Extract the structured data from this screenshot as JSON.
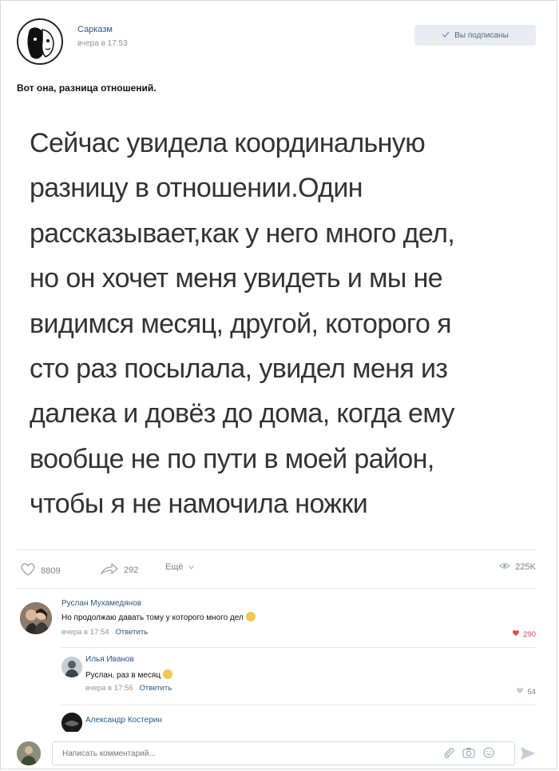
{
  "post": {
    "group_name": "Сарказм",
    "time": "вчера в 17:53",
    "subscribe_label": "Вы подписаны",
    "caption": "Вот она, разница отношений.",
    "body_lines": [
      "Сейчас увидела координальную",
      "разницу в отношении.Один",
      "рассказывает,как у него много дел,",
      "но он хочет меня увидеть и мы не",
      "видимся месяц, другой, которого я",
      "сто раз посылала, увидел меня из",
      "далека и довёз до дома, когда ему",
      "вообще не по пути в моей район,",
      "чтобы я не намочила ножки"
    ]
  },
  "actions": {
    "likes": "8809",
    "shares": "292",
    "more": "Ещё",
    "views": "225K"
  },
  "comments": [
    {
      "author": "Руслан Мухамедянов",
      "text": "Но продолжаю давать тому у которого много дел",
      "time": "вчера в 17:54",
      "reply": "Ответить",
      "likes": "290",
      "liked": true,
      "emoji": "laugh-cry-emoji"
    },
    {
      "author": "Илья Иванов",
      "text": "Руслан, раз в месяц",
      "time": "вчера в 17:56",
      "reply": "Ответить",
      "likes": "54",
      "liked": false,
      "emoji": "grin-emoji"
    },
    {
      "author": "Александр Костерин",
      "text": ""
    }
  ],
  "compose": {
    "placeholder": "Написать комментарий..."
  },
  "colors": {
    "link": "#2a5885",
    "like_active": "#e64646",
    "meta": "#939393"
  }
}
